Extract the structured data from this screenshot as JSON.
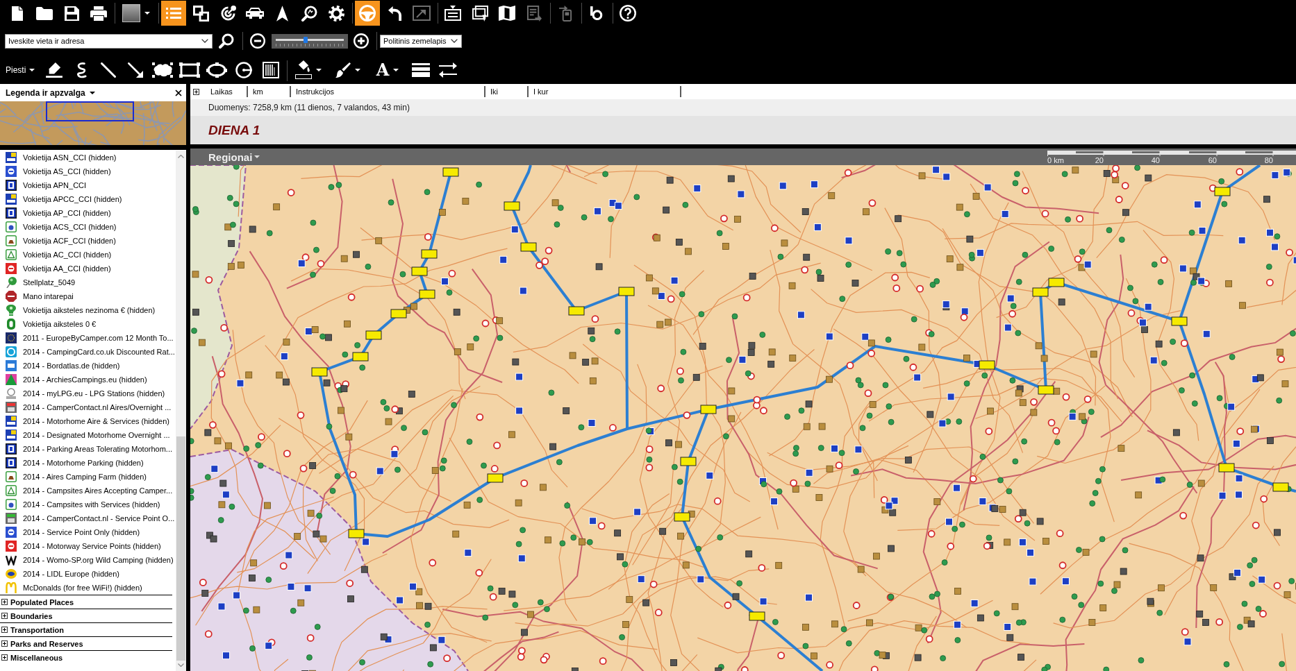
{
  "toolbar": [
    {
      "selected": false,
      "disabled": false
    },
    {
      "selected": false,
      "disabled": false
    },
    {
      "selected": false,
      "disabled": false
    },
    {
      "selected": false,
      "disabled": false
    },
    {
      "selected": false,
      "disabled": false
    },
    {
      "selected": true,
      "disabled": false
    },
    {
      "selected": false,
      "disabled": false
    },
    {
      "selected": false,
      "disabled": false
    },
    {
      "selected": false,
      "disabled": false
    },
    {
      "selected": false,
      "disabled": false
    },
    {
      "selected": false,
      "disabled": false
    },
    {
      "selected": false,
      "disabled": false
    },
    {
      "selected": true,
      "disabled": false
    },
    {
      "selected": false,
      "disabled": false
    },
    {
      "selected": false,
      "disabled": true
    },
    {
      "selected": false,
      "disabled": false
    },
    {
      "selected": false,
      "disabled": false
    },
    {
      "selected": false,
      "disabled": false
    },
    {
      "selected": false,
      "disabled": true
    },
    {
      "selected": false,
      "disabled": true
    },
    {
      "selected": false,
      "disabled": false
    },
    {
      "selected": false,
      "disabled": false
    }
  ],
  "search": {
    "placeholder": "Iveskite vieta ir adresa"
  },
  "zoom": {
    "level": 0.44
  },
  "map_type": {
    "value": "Politinis zemelapis"
  },
  "draw_toolbar": {
    "menu": "Piesti",
    "text_tool": "A"
  },
  "legend": {
    "title": "Legenda ir apzvalga",
    "items": [
      {
        "label": "Vokietija ASN_CCI (hidden)"
      },
      {
        "label": "Vokietija AS_CCI (hidden)"
      },
      {
        "label": "Vokietija APN_CCI"
      },
      {
        "label": "Vokietija APCC_CCI (hidden)"
      },
      {
        "label": "Vokietija AP_CCI (hidden)"
      },
      {
        "label": "Vokietija ACS_CCI (hidden)"
      },
      {
        "label": "Vokietija ACF_CCI (hidden)"
      },
      {
        "label": "Vokietija AC_CCI (hidden)"
      },
      {
        "label": "Vokietija AA_CCI (hidden)"
      },
      {
        "label": "Stellplatz_5049"
      },
      {
        "label": "Mano intarepai"
      },
      {
        "label": "Vokietija aiksteles nezinoma € (hidden)"
      },
      {
        "label": "Vokietija aiksteles 0 €"
      },
      {
        "label": "2011 - EuropeByCamper.com 12 Month To..."
      },
      {
        "label": "2014 - CampingCard.co.uk Discounted Rat..."
      },
      {
        "label": "2014 - Bordatlas.de (hidden)"
      },
      {
        "label": "2014 - ArchiesCampings.eu (hidden)"
      },
      {
        "label": "2014 - myLPG.eu - LPG Stations (hidden)"
      },
      {
        "label": "2014 - CamperContact.nl Aires/Overnight ..."
      },
      {
        "label": "2014 - Motorhome Aire & Services (hidden)"
      },
      {
        "label": "2014 - Designated Motorhome Overnight ..."
      },
      {
        "label": "2014 - Parking Areas Tolerating Motorhom..."
      },
      {
        "label": "2014 - Motorhome Parking (hidden)"
      },
      {
        "label": "2014 - Aires Camping Farm (hidden)"
      },
      {
        "label": "2014 - Campsites Aires Accepting Camper..."
      },
      {
        "label": "2014 - Campsites with Services (hidden)"
      },
      {
        "label": "2014 - CamperContact.nl - Service Point O..."
      },
      {
        "label": "2014 - Service Point Only (hidden)"
      },
      {
        "label": "2014 - Motorway Service Points (hidden)"
      },
      {
        "label": "2014 - Womo-SP.org Wild Camping (hidden)"
      },
      {
        "label": "2014 - LIDL Europe (hidden)"
      },
      {
        "label": "McDonalds (for free WiFi!) (hidden)"
      }
    ],
    "groups": [
      {
        "label": "Populated Places",
        "expanded": false
      },
      {
        "label": "Boundaries",
        "expanded": false
      },
      {
        "label": "Transportation",
        "expanded": false
      },
      {
        "label": "Parks and Reserves",
        "expanded": false
      },
      {
        "label": "Miscellaneous",
        "expanded": false
      }
    ]
  },
  "route_table": {
    "expanded": false,
    "columns": [
      "Laikas",
      "km",
      "Instrukcijos",
      "Iki",
      "I kur"
    ],
    "summary": "Duomenys: 7258,9 km (11 dienos, 7 valandos, 43 min)",
    "day": "DIENA 1"
  },
  "map": {
    "region_menu": "Regionai",
    "scale_labels": [
      "0 km",
      "20",
      "40",
      "60",
      "80"
    ]
  }
}
